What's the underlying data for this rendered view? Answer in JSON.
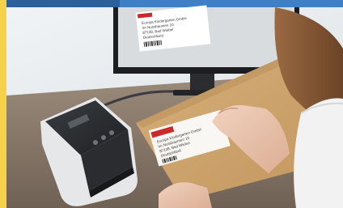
{
  "photo": {
    "screen_label_lines": [
      "Europa Kindergarten GmbH",
      "Im Nussbaumen 10",
      "87138, Bad Wiebel",
      "Deutschland"
    ],
    "held_label_lines": [
      "Europa Kindergarten GmbH",
      "Im Nussbaumen 10",
      "87138, Bad Wiebel",
      "Deutschland"
    ],
    "colors": {
      "frame_yellow": "#f6d24a",
      "top_band_blue": "#3f7fc5",
      "wall": "#e8ecef",
      "desk": "#8d7d6d",
      "envelope": "#cfa36b",
      "label_red": "#c92b2b",
      "printer_dark": "#2a2c2f",
      "printer_light": "#e6e7e8"
    }
  }
}
